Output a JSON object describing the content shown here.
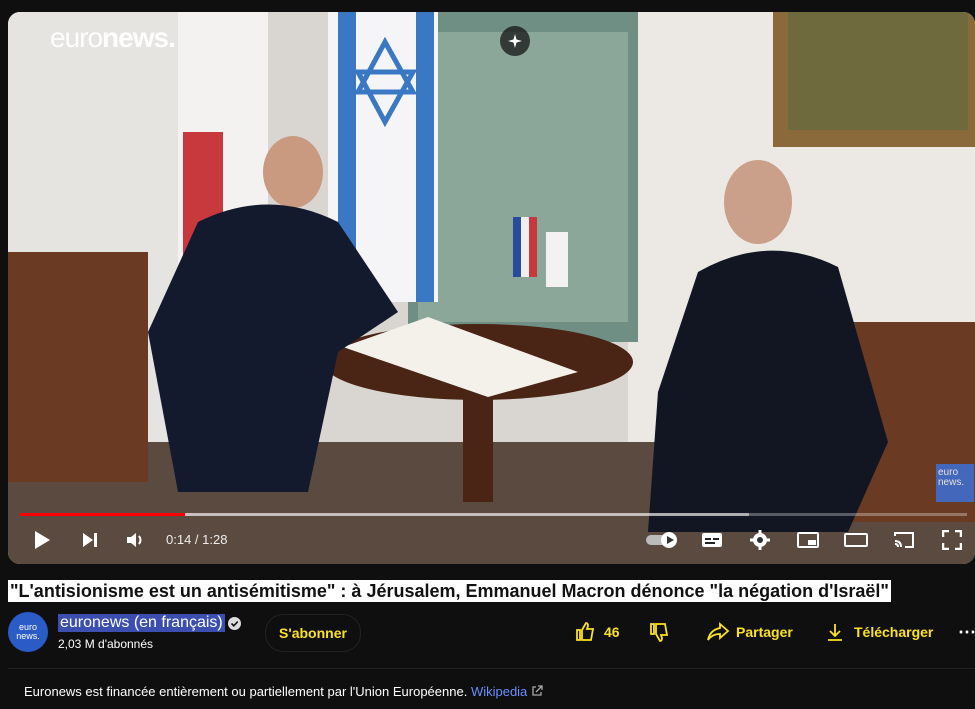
{
  "player": {
    "brand_main": "euro",
    "brand_bold": "news.",
    "watermark": "euro news.",
    "time_current": "0:14",
    "time_separator": " / ",
    "time_total": "1:28",
    "progress_fraction": 0.174,
    "buffer_fraction": 0.77,
    "controls": [
      "play-icon",
      "next-icon",
      "volume-icon",
      "autoplay-toggle",
      "subtitles-icon",
      "settings-icon",
      "miniplayer-icon",
      "theater-icon",
      "cast-icon",
      "fullscreen-icon"
    ]
  },
  "video": {
    "title": "\"L'antisionisme est un antisémitisme\" : à Jérusalem, Emmanuel Macron dénonce \"la négation d'Israël\""
  },
  "channel": {
    "name": "euronews (en français)",
    "subscribers": "2,03 M d'abonnés",
    "avatar_text": "euro news.",
    "subscribe_label": "S'abonner"
  },
  "actions": {
    "like_count": "46",
    "share_label": "Partager",
    "download_label": "Télécharger",
    "more": "⋯"
  },
  "description": {
    "text": "Euronews est financée entièrement ou partiellement par l'Union Européenne.",
    "link": "Wikipedia"
  },
  "colors": {
    "accent": "#fbe21f",
    "progress": "#ff0000",
    "link": "#6a8fff"
  }
}
